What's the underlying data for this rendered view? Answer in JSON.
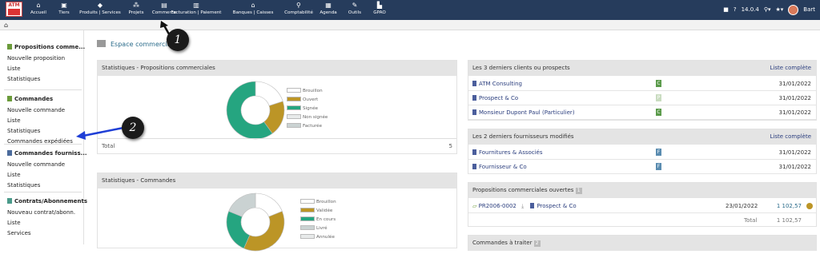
{
  "app": {
    "logo_text": "ATM"
  },
  "topmenu": [
    {
      "label": "Accueil",
      "icon": "home-icon",
      "glyph": "⌂"
    },
    {
      "label": "Tiers",
      "icon": "building-icon",
      "glyph": "▣"
    },
    {
      "label": "Produits | Services",
      "icon": "cube-icon",
      "glyph": "◆"
    },
    {
      "label": "Projets",
      "icon": "sitemap-icon",
      "glyph": "⁂"
    },
    {
      "label": "Commerce",
      "icon": "briefcase-icon",
      "glyph": "▤"
    },
    {
      "label": "Facturation | Paiement",
      "icon": "money-icon",
      "glyph": "▥"
    },
    {
      "label": "Banques | Caisses",
      "icon": "bank-icon",
      "glyph": "⌂"
    },
    {
      "label": "Comptabilité",
      "icon": "search-dollar-icon",
      "glyph": "⚲"
    },
    {
      "label": "Agenda",
      "icon": "calendar-icon",
      "glyph": "▦"
    },
    {
      "label": "Outils",
      "icon": "wrench-icon",
      "glyph": "✎"
    },
    {
      "label": "GPAO",
      "icon": "factory-icon",
      "glyph": "▙"
    }
  ],
  "toolbar": {
    "version": "14.0.4",
    "user": "Bart"
  },
  "sidebar": {
    "sections": [
      {
        "title": "Propositions comme...",
        "color": "#6b9b3a",
        "items": [
          "Nouvelle proposition",
          "Liste",
          "Statistiques"
        ]
      },
      {
        "title": "Commandes",
        "color": "#6b9b3a",
        "items": [
          "Nouvelle commande",
          "Liste",
          "Statistiques",
          "Commandes expédiées"
        ]
      },
      {
        "title": "Commandes fourniss...",
        "color": "#4b6b9c",
        "items": [
          "Nouvelle commande",
          "Liste",
          "Statistiques"
        ]
      },
      {
        "title": "Contrats/Abonnements",
        "color": "#4a9a8a",
        "items": [
          "Nouveau contrat/abonn.",
          "Liste",
          "Services"
        ]
      }
    ]
  },
  "page": {
    "title": "Espace commercial"
  },
  "stats_proposals": {
    "header": "Statistiques - Propositions commerciales",
    "total_label": "Total",
    "total_value": "5",
    "legend": [
      {
        "label": "Brouillon",
        "color": "#ffffff"
      },
      {
        "label": "Ouvert",
        "color": "#bc9526"
      },
      {
        "label": "Signée",
        "color": "#25a580"
      },
      {
        "label": "Non signée",
        "color": "#e8eaea"
      },
      {
        "label": "Facturée",
        "color": "#cad2d2"
      }
    ],
    "slices": [
      {
        "label": "Brouillon",
        "value": 1,
        "color": "#ffffff"
      },
      {
        "label": "Ouvert",
        "value": 1,
        "color": "#bc9526"
      },
      {
        "label": "Signée",
        "value": 3,
        "color": "#25a580"
      }
    ]
  },
  "stats_orders": {
    "header": "Statistiques - Commandes",
    "legend": [
      {
        "label": "Brouillon",
        "color": "#ffffff"
      },
      {
        "label": "Validée",
        "color": "#bc9526"
      },
      {
        "label": "En cours",
        "color": "#25a580"
      },
      {
        "label": "Livré",
        "color": "#cad2d2"
      },
      {
        "label": "Annulée",
        "color": "#e8eaea"
      }
    ],
    "slices": [
      {
        "label": "Brouillon",
        "value": 1,
        "color": "#ffffff"
      },
      {
        "label": "Validée",
        "value": 2,
        "color": "#bc9526"
      },
      {
        "label": "En cours",
        "value": 1.3,
        "color": "#25a580"
      },
      {
        "label": "Livré",
        "value": 1,
        "color": "#cad2d2"
      }
    ]
  },
  "last_clients": {
    "header": "Les 3 derniers clients ou prospects",
    "link": "Liste complète",
    "rows": [
      {
        "name": "ATM Consulting",
        "badge": "C",
        "badge_color": "#5a9a4a",
        "date": "31/01/2022"
      },
      {
        "name": "Prospect & Co",
        "badge": "P",
        "badge_color": "#c9dcc0",
        "date": "31/01/2022"
      },
      {
        "name": "Monsieur Dupont Paul (Particulier)",
        "badge": "C",
        "badge_color": "#5a9a4a",
        "date": "31/01/2022"
      }
    ]
  },
  "last_suppliers": {
    "header": "Les 2 derniers fournisseurs modifiés",
    "link": "Liste complète",
    "rows": [
      {
        "name": "Fournitures & Associés",
        "badge": "F",
        "badge_color": "#5a8cb0",
        "date": "31/01/2022"
      },
      {
        "name": "Fournisseur & Co",
        "badge": "F",
        "badge_color": "#5a8cb0",
        "date": "31/01/2022"
      }
    ]
  },
  "open_proposals": {
    "header": "Propositions commerciales ouvertes",
    "count": "1",
    "ref": "PR2006-0002",
    "thirdparty": "Prospect & Co",
    "date": "23/01/2022",
    "amount": "1 102,57",
    "total_label": "Total",
    "total_value": "1 102,57"
  },
  "orders_todo": {
    "header": "Commandes à traiter",
    "count": "2"
  },
  "annotations": {
    "one": "1",
    "two": "2"
  }
}
